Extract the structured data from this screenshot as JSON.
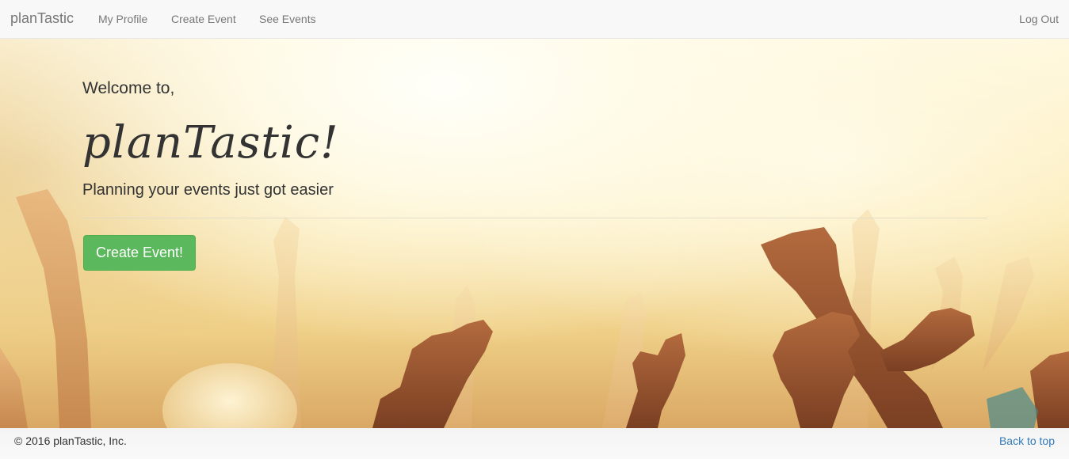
{
  "navbar": {
    "brand": "planTastic",
    "links": {
      "profile": "My Profile",
      "create_event": "Create Event",
      "see_events": "See Events"
    },
    "logout": "Log Out"
  },
  "hero": {
    "welcome": "Welcome to,",
    "title": "planTastic!",
    "tagline": "Planning your events just got easier",
    "cta_label": "Create Event!",
    "background": "concert-crowd-hands-image"
  },
  "footer": {
    "copyright": "© 2016 planTastic, Inc.",
    "back_to_top": "Back to top"
  },
  "colors": {
    "navbar_bg": "#f8f8f8",
    "nav_text": "#777777",
    "cta_green": "#5cb85c",
    "link_blue": "#337ab7",
    "text_dark": "#333333"
  }
}
